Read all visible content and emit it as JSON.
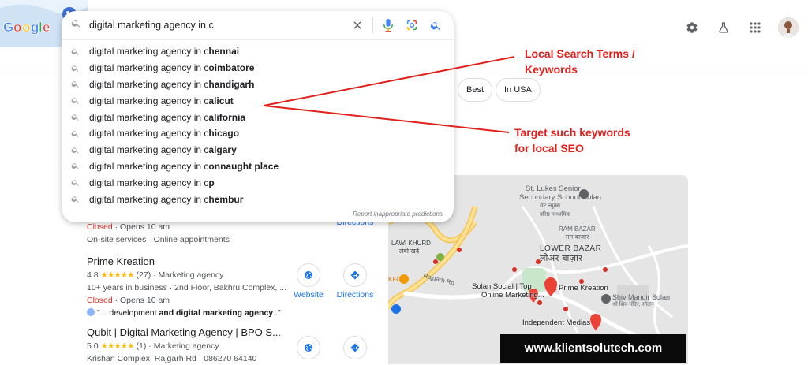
{
  "search": {
    "query": "digital marketing agency in c",
    "suggestions": [
      {
        "prefix": "digital marketing agency in c",
        "completion": "hennai"
      },
      {
        "prefix": "digital marketing agency in c",
        "completion": "oimbatore"
      },
      {
        "prefix": "digital marketing agency in c",
        "completion": "handigarh"
      },
      {
        "prefix": "digital marketing agency in c",
        "completion": "alicut"
      },
      {
        "prefix": "digital marketing agency in c",
        "completion": "alifornia"
      },
      {
        "prefix": "digital marketing agency in c",
        "completion": "hicago"
      },
      {
        "prefix": "digital marketing agency in c",
        "completion": "algary"
      },
      {
        "prefix": "digital marketing agency in c",
        "completion": "onnaught place"
      },
      {
        "prefix": "digital marketing agency in c",
        "completion": "p"
      },
      {
        "prefix": "digital marketing agency in c",
        "completion": "hembur"
      }
    ],
    "report_label": "Report inappropriate predictions"
  },
  "chips": {
    "best": "Best",
    "in_usa": "In USA"
  },
  "results": {
    "first": {
      "closed": "Closed",
      "hours": " · Opens 10 am",
      "services": "On-site services · Online appointments",
      "directions": "Directions"
    },
    "second": {
      "name": "Prime Kreation",
      "rating": "4.8",
      "stars": "★★★★★",
      "count_type": "(27) · Marketing agency",
      "details": "10+ years in business · 2nd Floor, Bakhru Complex, ...",
      "closed": "Closed",
      "hours": " · Opens 10 am",
      "review_pre": "\"... development ",
      "review_bold": "and digital marketing agency",
      "review_post": "..\"",
      "website": "Website",
      "directions": "Directions"
    },
    "third": {
      "name": "Qubit | Digital Marketing Agency | BPO S...",
      "rating": "5.0",
      "stars": "★★★★★",
      "count_type": "(1) · Marketing agency",
      "details": "Krishan Complex, Rajgarh Rd · 086270 64140"
    }
  },
  "map": {
    "school": "St. Lukes Senior",
    "school2": "Secondary School Solan",
    "school_hi": "सेंट ल्यूक्स",
    "school_hi2": "वरिष्ठ माध्यमिक",
    "ram_bazar": "RAM BAZAR",
    "ram_bazar_hi": "राम बाज़ार",
    "lower_bazar": "LOWER BAZAR",
    "lower_bazar_hi": "लोअर बाज़ार",
    "lawi_khurd": "LAWI KHURD",
    "lawi_khurd_hi": "लवी खर्द",
    "rajgarh": "Rajgarh Rd",
    "kfc": "KFC",
    "solan_social": "Solan Social | Top",
    "solan_social2": "Online Marketing...",
    "prime_kreation": "Prime Kreation",
    "shiv_mandir": "Shiv Mandir Solan",
    "shiv_mandir_hi": "श्री शिव मंदिर, सोलन",
    "independent": "Independent Medias"
  },
  "annotations": {
    "local_terms_line1": "Local Search Terms /",
    "local_terms_line2": "Keywords",
    "target_line1": "Target such keywords",
    "target_line2": "for local SEO",
    "watermark": "www.klientsolutech.com"
  },
  "colors": {
    "annotation": "#e0201b",
    "closed": "#d93025",
    "link": "#1a73e8",
    "star": "#fbbc04"
  }
}
